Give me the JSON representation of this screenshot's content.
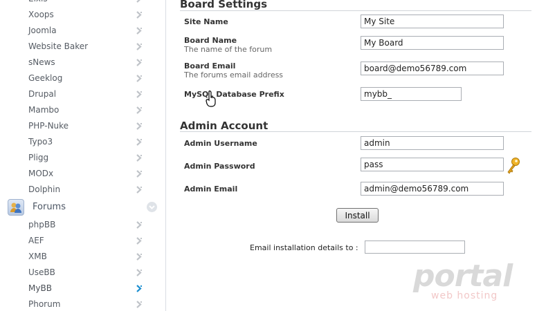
{
  "sidebar": {
    "items_top": [
      {
        "label": "Elxis"
      },
      {
        "label": "Xoops"
      },
      {
        "label": "Joomla"
      },
      {
        "label": "Website Baker"
      },
      {
        "label": "sNews"
      },
      {
        "label": "Geeklog"
      },
      {
        "label": "Drupal"
      },
      {
        "label": "Mambo"
      },
      {
        "label": "PHP-Nuke"
      },
      {
        "label": "Typo3"
      },
      {
        "label": "Pligg"
      },
      {
        "label": "MODx"
      },
      {
        "label": "Dolphin"
      }
    ],
    "category": {
      "label": "Forums",
      "icon": "forums-icon"
    },
    "items_forums": [
      {
        "label": "phpBB"
      },
      {
        "label": "AEF"
      },
      {
        "label": "XMB"
      },
      {
        "label": "UseBB"
      },
      {
        "label": "MyBB",
        "active": true
      },
      {
        "label": "Phorum"
      }
    ],
    "arrow_color": "#c0c4c9",
    "active_arrow_color": "#1d8fd1"
  },
  "board_settings": {
    "title": "Board Settings",
    "site_name": {
      "label": "Site Name",
      "value": "My Site"
    },
    "board_name": {
      "label": "Board Name",
      "sub": "The name of the forum",
      "value": "My Board"
    },
    "board_email": {
      "label": "Board Email",
      "sub": "The forums email address",
      "value": "board@demo56789.com"
    },
    "db_prefix": {
      "label": "MySQL Database Prefix",
      "value": "mybb_"
    }
  },
  "admin_account": {
    "title": "Admin Account",
    "username": {
      "label": "Admin Username",
      "value": "admin"
    },
    "password": {
      "label": "Admin Password",
      "value": "pass"
    },
    "email": {
      "label": "Admin Email",
      "value": "admin@demo56789.com"
    }
  },
  "install_label": "Install",
  "email_details": {
    "label": "Email installation details to :",
    "value": ""
  },
  "logo": {
    "brand": "portal",
    "tagline": "web hosting"
  }
}
